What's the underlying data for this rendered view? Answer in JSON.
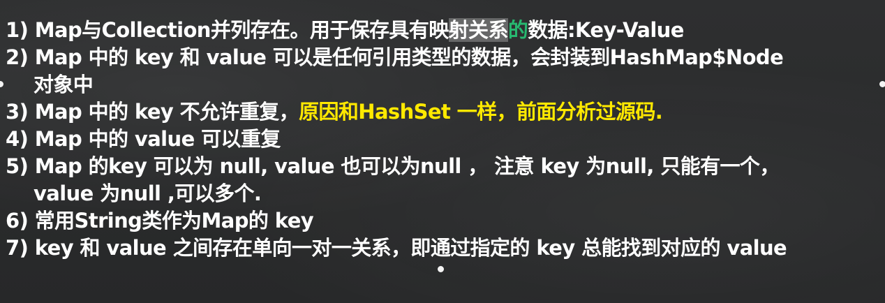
{
  "items": [
    {
      "num": "1)",
      "pre": " Map与Collection并列存在。用于保存具有映",
      "hl": "射关系",
      "green": "的",
      "post": "数据:Key-Value"
    },
    {
      "num": "2)",
      "text": " Map 中的 key 和  value 可以是任何引用类型的数据，会封装到HashMap$Node",
      "cont": "对象中"
    },
    {
      "num": "3)",
      "text": " Map 中的 key 不允许重复，",
      "yellow": "原因和HashSet 一样，前面分析过源码."
    },
    {
      "num": "4)",
      "text": " Map 中的 value 可以重复"
    },
    {
      "num": "5)",
      "text": " Map 的key 可以为 null, value 也可以为null ， 注意 key 为null, 只能有一个，",
      "cont": "value 为null ,可以多个."
    },
    {
      "num": "6)",
      "text": " 常用String类作为Map的 key"
    },
    {
      "num": "7)",
      "text": " key 和 value 之间存在单向一对一关系，即通过指定的 key 总能找到对应的 value"
    }
  ]
}
